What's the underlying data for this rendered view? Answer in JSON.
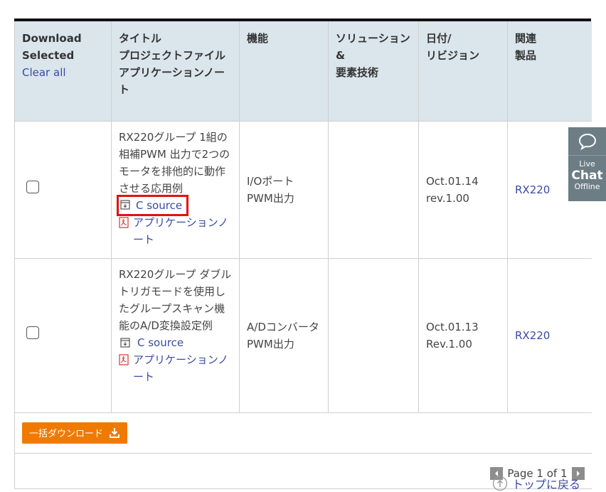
{
  "table": {
    "headers": {
      "download_title": "Download Selected",
      "clear_all": "Clear all",
      "title": [
        "タイトル",
        "プロジェクトファイル",
        "アプリケーションノート"
      ],
      "function": "機能",
      "solution": [
        "ソリューション&",
        "要素技術"
      ],
      "date": [
        "日付/",
        "リビジョン"
      ],
      "related": [
        "関連",
        "製品"
      ]
    },
    "rows": [
      {
        "title": "RX220グループ 1組の相補PWM 出力で2つのモータを排他的に動作させる応用例",
        "c_source": "C source",
        "app_note": "アプリケーションノート",
        "function": [
          "I/Oポート",
          "PWM出力"
        ],
        "solution": "",
        "date": "Oct.01.14",
        "revision": "rev.1.00",
        "product": "RX220"
      },
      {
        "title": "RX220グループ ダブルトリガモードを使用したグループスキャン機能のA/D変換設定例",
        "c_source": "C source",
        "app_note": "アプリケーションノート",
        "function": [
          "A/Dコンバータ",
          "PWM出力"
        ],
        "solution": "",
        "date": "Oct.01.13",
        "revision": "Rev.1.00",
        "product": "RX220"
      }
    ]
  },
  "bulk_download_label": "一括ダウンロード",
  "pager": {
    "text": "Page 1 of 1"
  },
  "back_to_top": "トップに戻る",
  "live_chat": {
    "line1": "Live",
    "line2": "Chat",
    "line3": "Offline"
  },
  "colors": {
    "accent": "#f07a00",
    "link": "#3a4aa4",
    "header_bg": "#dbe5ec",
    "highlight": "#e31010",
    "chat_bg": "#6d7d85"
  }
}
